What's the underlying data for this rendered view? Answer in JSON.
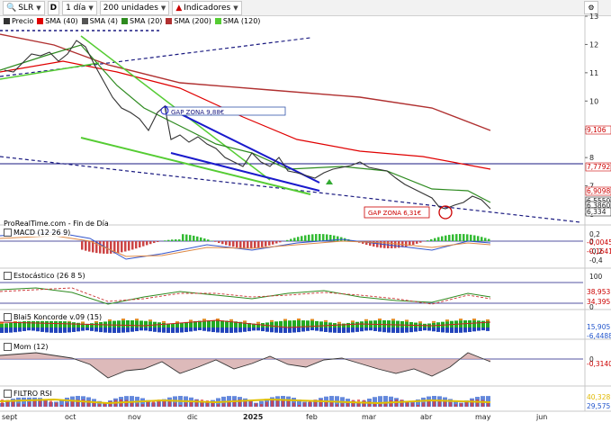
{
  "toolbar": {
    "symbol": "SLR",
    "interval": "1 día",
    "units": "200 unidades",
    "indicators_label": "Indicadores"
  },
  "legend": [
    {
      "label": "Precio",
      "color": "#333333"
    },
    {
      "label": "SMA (40)",
      "color": "#e00000"
    },
    {
      "label": "SMA (4)",
      "color": "#555555"
    },
    {
      "label": "SMA (20)",
      "color": "#2e8b20"
    },
    {
      "label": "SMA (200)",
      "color": "#b03030"
    },
    {
      "label": "SMA (120)",
      "color": "#55cc33"
    }
  ],
  "watermark": "ProRealTime.com - Fin de Día",
  "annotations": {
    "gap1": "GAP ZONA 9,88€",
    "gap2": "GAP ZONA 6,31€"
  },
  "x_labels": [
    "sept",
    "oct",
    "nov",
    "dic",
    "2025",
    "feb",
    "mar",
    "abr",
    "may",
    "jun"
  ],
  "main_axis": {
    "ticks": [
      "13",
      "12",
      "11",
      "10",
      "9",
      "8",
      "7",
      "6"
    ],
    "tags": [
      {
        "text": "9,106",
        "color": "#cc0000"
      },
      {
        "text": "7,7792",
        "color": "#cc0000"
      },
      {
        "text": "6,9098",
        "color": "#cc0000"
      },
      {
        "text": "6,5550",
        "color": "#222222"
      },
      {
        "text": "6,3860",
        "color": "#222222"
      },
      {
        "text": "6,334",
        "color": "#222222"
      }
    ]
  },
  "panels": {
    "macd": {
      "label": "MACD (12 26 9)",
      "ticks": [
        "0,2",
        "0",
        "-0,2",
        "-0,4"
      ],
      "tags": [
        {
          "text": "-0,0045",
          "color": "#cc0000"
        },
        {
          "text": "-0,1641",
          "color": "#cc0000"
        }
      ]
    },
    "stoch": {
      "label": "Estocástico (26 8 5)",
      "ticks": [
        "100",
        "0"
      ],
      "tags": [
        {
          "text": "38,953",
          "color": "#cc0000"
        },
        {
          "text": "34,395",
          "color": "#cc0000"
        }
      ]
    },
    "blai": {
      "label": "Blai5 Koncorde v.09 (15)",
      "ticks": [],
      "tags": [
        {
          "text": "15,905",
          "color": "#2255cc"
        },
        {
          "text": "-6,4488",
          "color": "#2255cc"
        }
      ]
    },
    "mom": {
      "label": "Mom (12)",
      "ticks": [
        "0"
      ],
      "tags": [
        {
          "text": "-0,3140",
          "color": "#cc0000"
        }
      ]
    },
    "rsi": {
      "label": "FILTRO RSI",
      "ticks": [],
      "tags": [
        {
          "text": "40,328",
          "color": "#e0b800"
        },
        {
          "text": "29,575",
          "color": "#2255cc"
        }
      ]
    }
  },
  "colors": {
    "price": "#333333",
    "sma40": "#e00000",
    "sma20": "#2e8b20",
    "sma200": "#b03030",
    "sma120": "#55cc33",
    "trend_blue": "#1a1acc",
    "trend_green": "#33cc33",
    "level": "#1a1a80"
  },
  "chart_data": {
    "type": "line",
    "series": [
      {
        "name": "Precio",
        "x": [
          "sept",
          "sept",
          "sept",
          "oct",
          "oct",
          "oct",
          "oct",
          "nov",
          "nov",
          "nov",
          "nov",
          "dic",
          "dic",
          "dic",
          "dic",
          "2025",
          "2025",
          "2025",
          "feb",
          "feb",
          "feb",
          "mar",
          "mar",
          "mar",
          "abr",
          "abr",
          "abr",
          "abr",
          "may",
          "may"
        ],
        "values": [
          11.2,
          11.6,
          12.0,
          11.9,
          12.3,
          12.1,
          11.4,
          10.5,
          10.1,
          9.6,
          9.9,
          9.0,
          8.8,
          8.5,
          8.3,
          8.2,
          8.4,
          8.0,
          7.8,
          7.7,
          7.9,
          8.0,
          7.9,
          7.7,
          7.5,
          7.0,
          6.5,
          6.7,
          6.9,
          6.4
        ]
      },
      {
        "name": "SMA (200)",
        "values": [
          12.3,
          12.1,
          11.9,
          11.7,
          11.5,
          11.3,
          11.1,
          10.95,
          10.8,
          10.7,
          10.6,
          10.5,
          10.4,
          10.3,
          10.2,
          10.1,
          10.0,
          9.9,
          9.8,
          9.7,
          9.6,
          9.5,
          9.4,
          9.3,
          9.2,
          9.15,
          9.13,
          9.12,
          9.11,
          9.106
        ]
      },
      {
        "name": "SMA (40)",
        "values": [
          11.1,
          11.2,
          11.3,
          11.4,
          11.5,
          11.4,
          11.2,
          10.9,
          10.6,
          10.3,
          10.0,
          9.7,
          9.4,
          9.2,
          9.0,
          8.8,
          8.6,
          8.5,
          8.35,
          8.2,
          8.1,
          8.0,
          7.95,
          7.9,
          7.85,
          7.8,
          7.75,
          7.6,
          7.3,
          6.91
        ]
      }
    ],
    "x_labels": [
      "sept",
      "oct",
      "nov",
      "dic",
      "2025",
      "feb",
      "mar",
      "abr",
      "may",
      "jun"
    ],
    "ylim": [
      6,
      13
    ],
    "grid": false,
    "legend": "top-left"
  }
}
